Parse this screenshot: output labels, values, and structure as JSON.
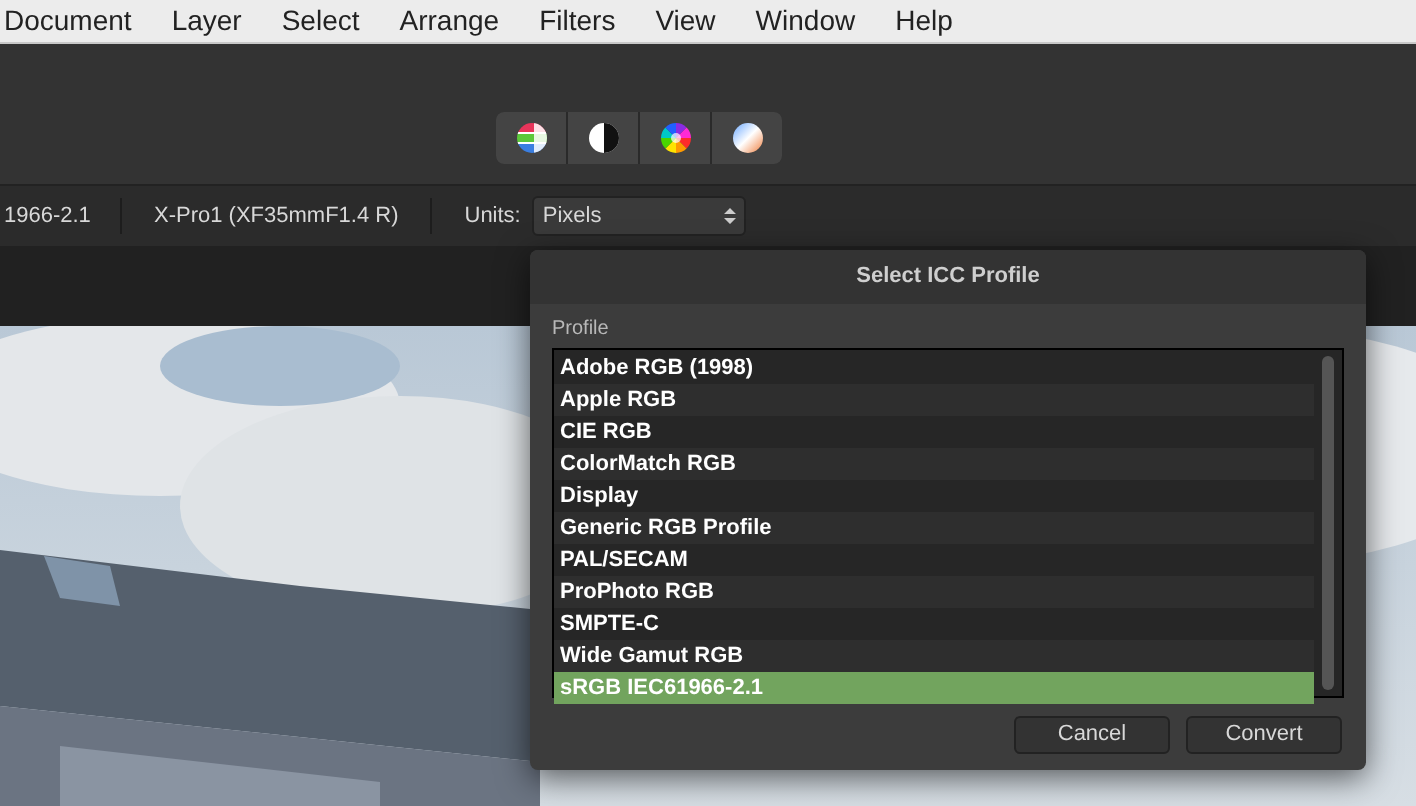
{
  "menu_bar": [
    "Document",
    "Layer",
    "Select",
    "Arrange",
    "Filters",
    "View",
    "Window",
    "Help"
  ],
  "toolbar": {
    "buttons": [
      {
        "kind": "channels"
      },
      {
        "kind": "contrast"
      },
      {
        "kind": "wheel"
      },
      {
        "kind": "gradient"
      }
    ]
  },
  "context_bar": {
    "profile": "1966-2.1",
    "camera": "X-Pro1 (XF35mmF1.4 R)",
    "units_label": "Units:",
    "units_value": "Pixels"
  },
  "dialog": {
    "title": "Select ICC Profile",
    "list_label": "Profile",
    "profiles": [
      {
        "label": "Adobe RGB (1998)",
        "selected": false
      },
      {
        "label": "Apple RGB",
        "selected": false
      },
      {
        "label": "CIE RGB",
        "selected": false
      },
      {
        "label": "ColorMatch RGB",
        "selected": false
      },
      {
        "label": "Display",
        "selected": false
      },
      {
        "label": "Generic RGB Profile",
        "selected": false
      },
      {
        "label": "PAL/SECAM",
        "selected": false
      },
      {
        "label": "ProPhoto RGB",
        "selected": false
      },
      {
        "label": "SMPTE-C",
        "selected": false
      },
      {
        "label": "Wide Gamut RGB",
        "selected": false
      },
      {
        "label": "sRGB IEC61966-2.1",
        "selected": true
      }
    ],
    "buttons": [
      "Cancel",
      "Convert"
    ]
  }
}
